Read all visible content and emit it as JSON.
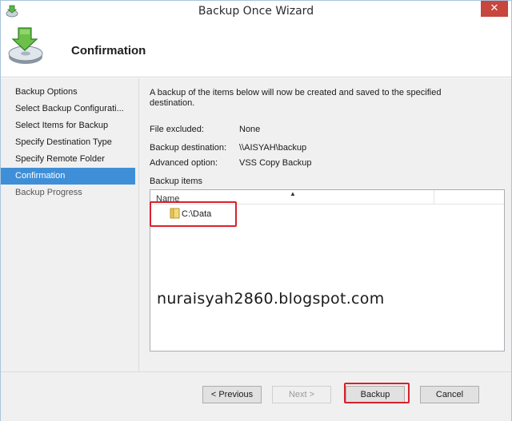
{
  "window": {
    "title": "Backup Once Wizard",
    "close_glyph": "✕"
  },
  "header": {
    "title": "Confirmation",
    "icon": "backup-disk-icon"
  },
  "steps": [
    {
      "label": "Backup Options",
      "state": "done"
    },
    {
      "label": "Select Backup Configurati...",
      "state": "done"
    },
    {
      "label": "Select Items for Backup",
      "state": "done"
    },
    {
      "label": "Specify Destination Type",
      "state": "done"
    },
    {
      "label": "Specify Remote Folder",
      "state": "done"
    },
    {
      "label": "Confirmation",
      "state": "active"
    },
    {
      "label": "Backup Progress",
      "state": "pending"
    }
  ],
  "content": {
    "intro": "A backup of the items below will now be created and saved to the specified destination.",
    "file_excluded_label": "File excluded:",
    "file_excluded_value": "None",
    "destination_label": "Backup destination:",
    "destination_value": "\\\\AISYAH\\backup",
    "advanced_label": "Advanced option:",
    "advanced_value": "VSS Copy Backup",
    "items_label": "Backup items",
    "column_name": "Name",
    "items": [
      {
        "name": "C:\\Data",
        "icon": "folder-icon"
      }
    ]
  },
  "watermark": "nuraisyah2860.blogspot.com",
  "buttons": {
    "previous": "< Previous",
    "next": "Next >",
    "backup": "Backup",
    "cancel": "Cancel"
  },
  "colors": {
    "accent": "#3f8fd8",
    "highlight_box": "#d9212b",
    "close": "#c7463d"
  }
}
